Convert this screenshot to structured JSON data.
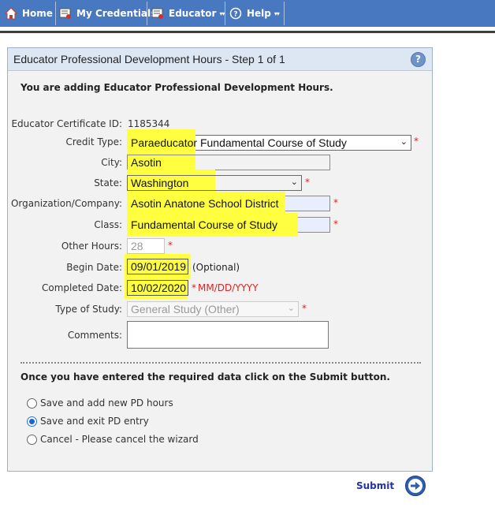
{
  "nav": {
    "items": [
      {
        "label": "Home",
        "icon": "home-icon",
        "has_caret": false
      },
      {
        "label": "My Credentials",
        "icon": "credentials-icon",
        "has_caret": false
      },
      {
        "label": "Educator",
        "icon": "educator-icon",
        "has_caret": true
      },
      {
        "label": "Help",
        "icon": "help-icon",
        "has_caret": true
      }
    ],
    "caret_glyph": "▾▾"
  },
  "panel": {
    "title": "Educator Professional Development Hours - Step 1 of 1",
    "help_glyph": "?",
    "intro": "You are adding Educator Professional Development Hours."
  },
  "form": {
    "cert_id_label": "Educator Certificate ID:",
    "cert_id_value": "1185344",
    "credit_type_label": "Credit Type:",
    "credit_type_value": "Paraeducator Fundamental Course of Study",
    "city_label": "City:",
    "city_value": "Asotin",
    "state_label": "State:",
    "state_value": "Washington",
    "org_label": "Organization/Company:",
    "org_value": "Asotin Anatone School District",
    "class_label": "Class:",
    "class_value": "Fundamental Course of Study",
    "other_hours_label": "Other Hours:",
    "other_hours_value": "28",
    "begin_date_label": "Begin Date:",
    "begin_date_value": "09/01/2019",
    "begin_date_note": "(Optional)",
    "completed_date_label": "Completed Date:",
    "completed_date_value": "10/02/2020",
    "completed_date_format": "MM/DD/YYYY",
    "type_of_study_label": "Type of Study:",
    "type_of_study_value": "General Study (Other)",
    "comments_label": "Comments:",
    "comments_value": "",
    "required_mark": "*",
    "dropdown_glyph": "⌄"
  },
  "instructions": "Once you have entered the required data click on the Submit button.",
  "options": [
    {
      "label": "Save and add new PD hours",
      "checked": false
    },
    {
      "label": "Save and exit PD entry",
      "checked": true
    },
    {
      "label": "Cancel - Please cancel the wizard",
      "checked": false
    }
  ],
  "submit_label": "Submit",
  "colors": {
    "nav_bg": "#4878c0",
    "highlight": "#ffff40",
    "required": "#e02020",
    "submit": "#2233aa"
  }
}
